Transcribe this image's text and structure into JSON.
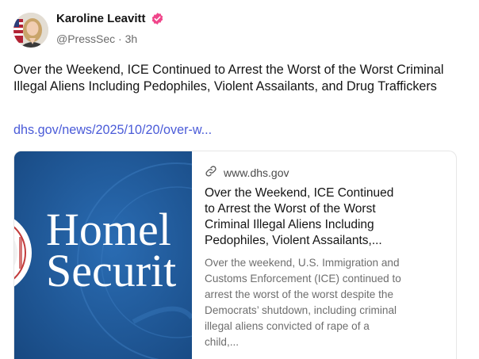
{
  "author": {
    "display_name": "Karoline Leavitt",
    "handle": "@PressSec",
    "separator": "·",
    "time_ago": "3h",
    "verified_color": "#f0458a"
  },
  "post": {
    "text": "Over the Weekend, ICE Continued to Arrest the Worst of the Worst Criminal Illegal Aliens Including Pedophiles, Violent Assailants, and Drug Traffickers",
    "link_text": "dhs.gov/news/2025/10/20/over-w..."
  },
  "card": {
    "domain": "www.dhs.gov",
    "title_lines": [
      "Over the Weekend, ICE Continued",
      "to Arrest the Worst of the Worst",
      "Criminal Illegal Aliens Including",
      "Pedophiles, Violent Assailants,..."
    ],
    "description_lines": [
      "Over the weekend, U.S. Immigration and",
      "Customs Enforcement (ICE) continued to",
      "arrest the worst of the worst despite the",
      "Democrats’ shutdown, including criminal",
      "illegal aliens convicted of rape of a",
      "child,..."
    ],
    "image": {
      "text_line1": "Homel",
      "text_line2": "Securit",
      "background_color": "#1f5a9b"
    }
  },
  "icons": {
    "link_icon": "link-icon",
    "verified_icon": "verified-badge-icon"
  }
}
